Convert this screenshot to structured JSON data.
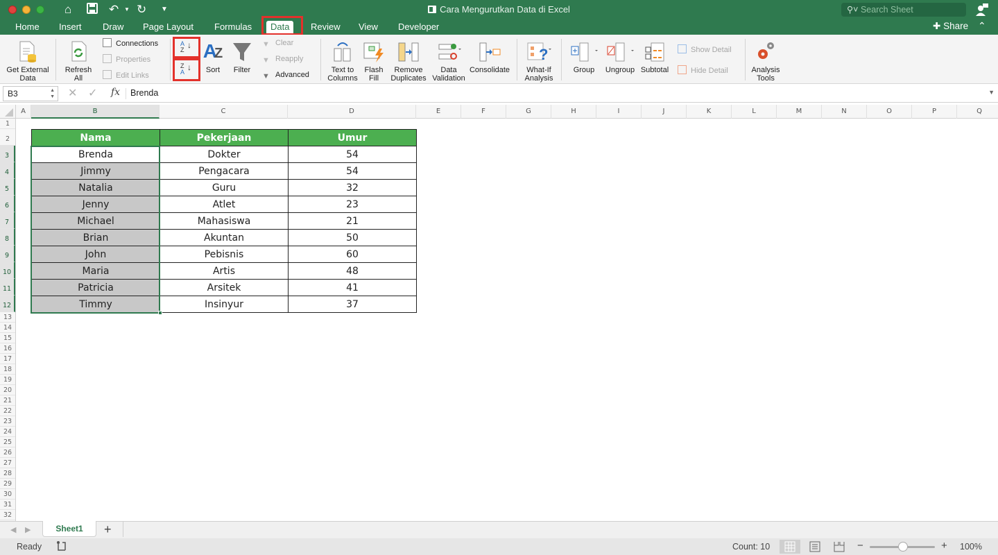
{
  "window": {
    "title": "Cara Mengurutkan Data di Excel",
    "search_placeholder": "Search Sheet"
  },
  "quick_access": [
    "home-icon",
    "save-icon",
    "undo-icon",
    "redo-icon",
    "customize-icon"
  ],
  "tabs": [
    {
      "label": "Home"
    },
    {
      "label": "Insert"
    },
    {
      "label": "Draw"
    },
    {
      "label": "Page Layout"
    },
    {
      "label": "Formulas"
    },
    {
      "label": "Data",
      "active": true
    },
    {
      "label": "Review"
    },
    {
      "label": "View"
    },
    {
      "label": "Developer"
    }
  ],
  "share_label": "Share",
  "ribbon": {
    "get_external_data": "Get External Data",
    "get_external_data_l1": "Get External",
    "get_external_data_l2": "Data",
    "refresh_l1": "Refresh",
    "refresh_l2": "All",
    "connections": "Connections",
    "properties": "Properties",
    "edit_links": "Edit Links",
    "sort_az_top": "A",
    "sort_az_bottom": "Z",
    "sort_za_top": "Z",
    "sort_za_bottom": "A",
    "sort": "Sort",
    "filter": "Filter",
    "clear": "Clear",
    "reapply": "Reapply",
    "advanced": "Advanced",
    "text_to_columns_l1": "Text to",
    "text_to_columns_l2": "Columns",
    "flash_fill_l1": "Flash",
    "flash_fill_l2": "Fill",
    "remove_duplicates_l1": "Remove",
    "remove_duplicates_l2": "Duplicates",
    "data_validation_l1": "Data",
    "data_validation_l2": "Validation",
    "consolidate": "Consolidate",
    "what_if_l1": "What-If",
    "what_if_l2": "Analysis",
    "group": "Group",
    "ungroup": "Ungroup",
    "subtotal": "Subtotal",
    "show_detail": "Show Detail",
    "hide_detail": "Hide Detail",
    "analysis_tools_l1": "Analysis",
    "analysis_tools_l2": "Tools"
  },
  "formula_bar": {
    "name_box": "B3",
    "fx": "fx",
    "value": "Brenda"
  },
  "columns": [
    "A",
    "B",
    "C",
    "D",
    "E",
    "F",
    "G",
    "H",
    "I",
    "J",
    "K",
    "L",
    "M",
    "N",
    "O",
    "P",
    "Q"
  ],
  "rows": [
    "1",
    "2",
    "3",
    "4",
    "5",
    "6",
    "7",
    "8",
    "9",
    "10",
    "11",
    "12",
    "13",
    "14",
    "15",
    "16",
    "17",
    "18",
    "19",
    "20",
    "21",
    "22",
    "23",
    "24",
    "25",
    "26",
    "27",
    "28",
    "29",
    "30",
    "31",
    "32"
  ],
  "table": {
    "headers": [
      "Nama",
      "Pekerjaan",
      "Umur"
    ],
    "rows": [
      [
        "Brenda",
        "Dokter",
        "54"
      ],
      [
        "Jimmy",
        "Pengacara",
        "54"
      ],
      [
        "Natalia",
        "Guru",
        "32"
      ],
      [
        "Jenny",
        "Atlet",
        "23"
      ],
      [
        "Michael",
        "Mahasiswa",
        "21"
      ],
      [
        "Brian",
        "Akuntan",
        "50"
      ],
      [
        "John",
        "Pebisnis",
        "60"
      ],
      [
        "Maria",
        "Artis",
        "48"
      ],
      [
        "Patricia",
        "Arsitek",
        "41"
      ],
      [
        "Timmy",
        "Insinyur",
        "37"
      ]
    ],
    "header_color": "#4caf50",
    "selected_color": "#c8c8c8"
  },
  "sheets": [
    {
      "label": "Sheet1",
      "active": true
    }
  ],
  "add_sheet": "+",
  "status": {
    "ready": "Ready",
    "count": "Count: 10",
    "zoom_minus": "−",
    "zoom_plus": "+",
    "zoom": "100%",
    "zoom_level_percent": 100
  },
  "accent_color": "#2f7a4f",
  "highlight_color": "#e3312b"
}
